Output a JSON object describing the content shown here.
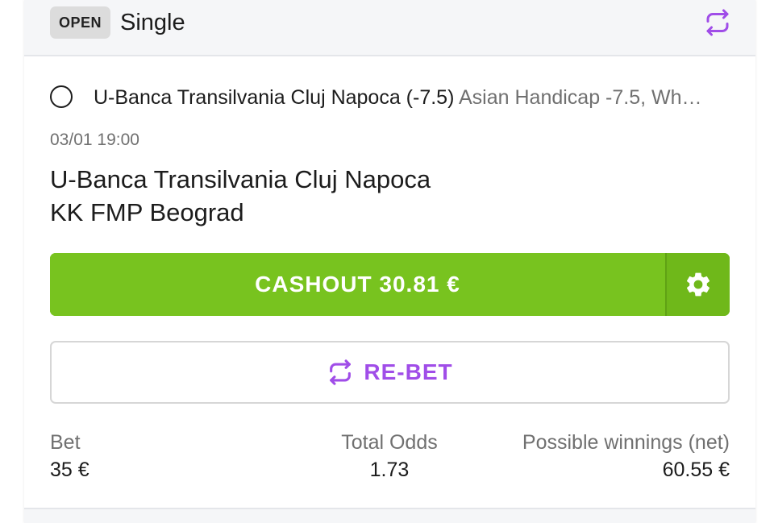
{
  "header": {
    "status": "OPEN",
    "bet_type": "Single"
  },
  "selection": {
    "name": "U-Banca Transilvania Cluj Napoca (-7.5)",
    "market": "Asian Handicap -7.5, Wh…"
  },
  "event": {
    "time": "03/01 19:00",
    "home_team": "U-Banca Transilvania Cluj Napoca",
    "away_team": "KK FMP Beograd"
  },
  "actions": {
    "cashout_label": "CASHOUT 30.81 €",
    "rebet_label": "RE-BET"
  },
  "summary": {
    "bet_label": "Bet",
    "bet_value": "35 €",
    "odds_label": "Total Odds",
    "odds_value": "1.73",
    "winnings_label": "Possible winnings (net)",
    "winnings_value": "60.55 €"
  },
  "icons": {
    "header_repeat": "repeat-icon",
    "cashout_settings": "gear-icon",
    "rebet": "repeat-icon"
  },
  "colors": {
    "cashout_green": "#78c31f",
    "rebet_purple": "#a04de8",
    "badge_gray": "#dcdcdc"
  }
}
